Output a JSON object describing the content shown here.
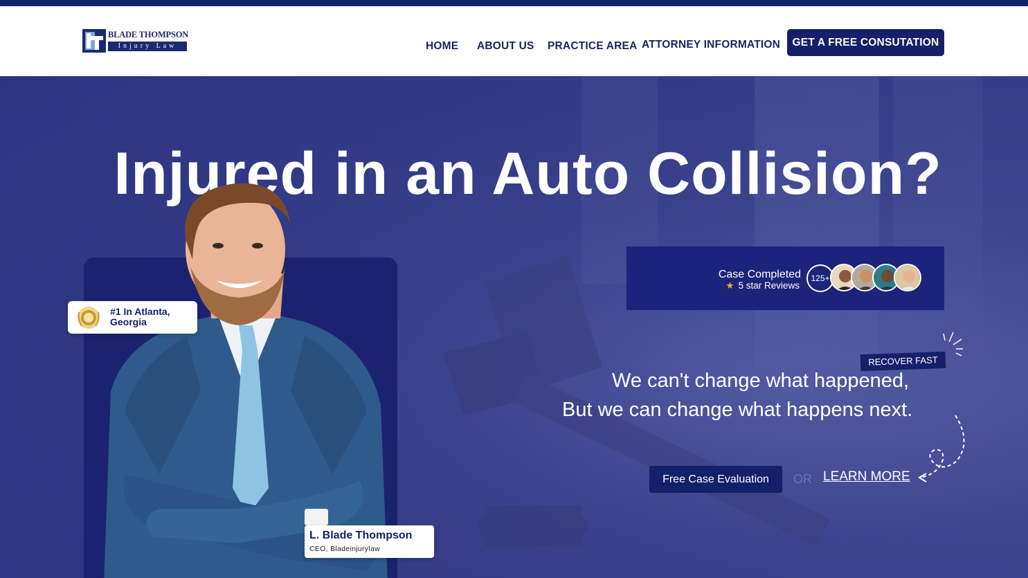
{
  "brand": {
    "name": "BLADE THOMPSON",
    "subtitle": "Injury Law",
    "accent": "#14206a"
  },
  "nav": {
    "items": [
      {
        "label": "HOME"
      },
      {
        "label": "ABOUT US"
      },
      {
        "label": "PRACTICE AREA"
      },
      {
        "label": "ATTORNEY INFORMATION"
      }
    ],
    "cta_label": "GET A FREE CONSUTATION"
  },
  "hero": {
    "title": "Injured in an Auto Collision?",
    "badge_atlanta": "#1 In Atlanta, Georgia",
    "attorney": {
      "name": "L. Blade Thompson",
      "role": "CEO, Bladeinjurylaw"
    },
    "cases": {
      "title": "Case Completed",
      "reviews": "5 star Reviews",
      "count": "125+"
    },
    "recover_badge": "RECOVER FAST",
    "tagline_line1": "We can't change what happened,",
    "tagline_line2": "But we can change what happens next.",
    "eval_button": "Free Case Evaluation",
    "or_text": "OR",
    "learn_more": "LEARN MORE"
  }
}
